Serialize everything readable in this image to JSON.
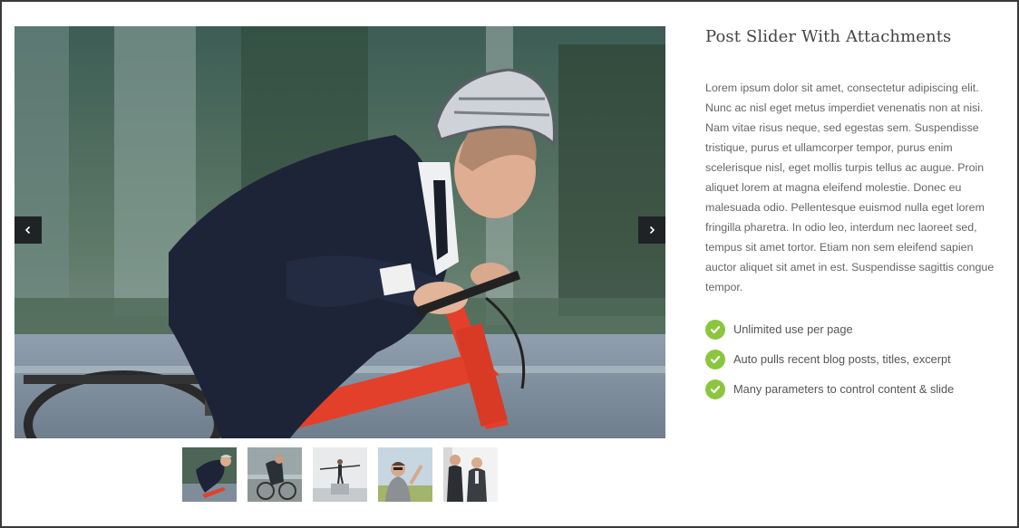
{
  "slider": {
    "main_image": "cyclist-businessman-photo",
    "prev_icon": "chevron-left-icon",
    "next_icon": "chevron-right-icon",
    "thumbnails": [
      {
        "image": "cyclist-businessman-thumb"
      },
      {
        "image": "cyclist-motion-blur-thumb"
      },
      {
        "image": "tightrope-walker-thumb"
      },
      {
        "image": "man-pointing-thumb"
      },
      {
        "image": "two-businessmen-thumb"
      }
    ]
  },
  "content": {
    "title": "Post Slider With Attachments",
    "paragraph": "Lorem ipsum dolor sit amet, consectetur adipiscing elit. Nunc ac nisl eget metus imperdiet venenatis non at nisi. Nam vitae risus neque, sed egestas sem. Suspendisse tristique, purus et ullamcorper tempor, purus enim scelerisque nisl, eget mollis turpis tellus ac augue. Proin aliquet lorem at magna eleifend molestie. Donec eu malesuada odio. Pellentesque euismod nulla eget lorem fringilla pharetra. In odio leo, interdum nec laoreet sed, tempus sit amet tortor. Etiam non sem eleifend sapien auctor aliquet sit amet in est. Suspendisse sagittis congue tempor.",
    "features": [
      {
        "label": "Unlimited use per page",
        "icon": "check-circle-icon"
      },
      {
        "label": "Auto pulls recent blog posts, titles, excerpt",
        "icon": "check-circle-icon"
      },
      {
        "label": "Many parameters to control content & slide",
        "icon": "check-circle-icon"
      }
    ]
  },
  "colors": {
    "check_green": "#8cc63f",
    "arrow_bg": "#1f2326",
    "frame_border": "#3a3a3a",
    "title_text": "#444444",
    "body_text": "#666666"
  }
}
